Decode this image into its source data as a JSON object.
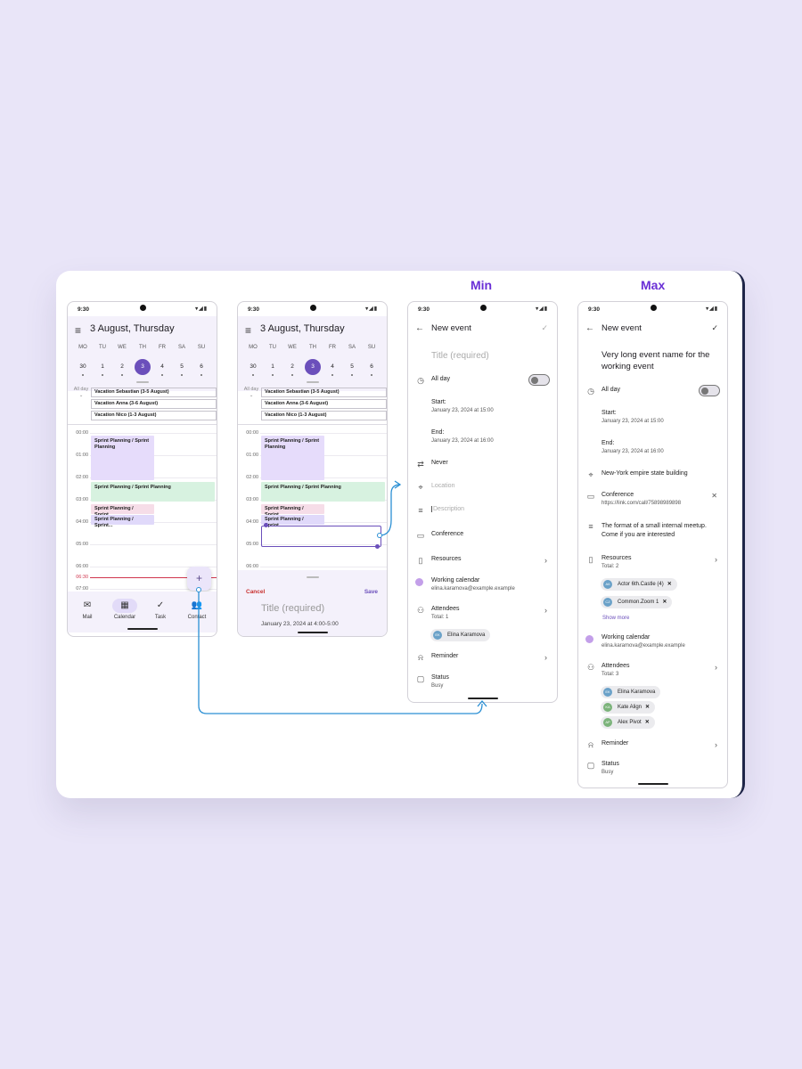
{
  "labels": {
    "min": "Min",
    "max": "Max"
  },
  "status": {
    "time": "9:30"
  },
  "calendar": {
    "title": "3 August, Thursday",
    "weekdays": [
      "MO",
      "TU",
      "WE",
      "TH",
      "FR",
      "SA",
      "SU"
    ],
    "dates": [
      "30",
      "1",
      "2",
      "3",
      "4",
      "5",
      "6"
    ],
    "selected_date": "3",
    "allday_label": "All day",
    "vacations": [
      "Vacation Sebastian (3-5 August)",
      "Vacation Anna (3-6 August)",
      "Vacation Nico (1-3 August)"
    ],
    "hours": [
      "00:00",
      "01:00",
      "02:00",
      "03:00",
      "04:00",
      "05:00",
      "06:00",
      "07:00"
    ],
    "now_time": "06:30",
    "events": [
      "Sprint Planning  / Sprint Planning",
      "Sprint Planning / Sprint Planning",
      "Sprint Planning / Sprint...",
      "Sprint Planning / Sprint..."
    ],
    "fab": "+",
    "nav": [
      {
        "icon": "✉",
        "label": "Mail"
      },
      {
        "icon": "▦",
        "label": "Calendar"
      },
      {
        "icon": "✓",
        "label": "Task"
      },
      {
        "icon": "👥",
        "label": "Contact"
      }
    ]
  },
  "quick_create": {
    "cancel": "Cancel",
    "save": "Save",
    "title_placeholder": "Title (required)",
    "datetime": "January 23, 2024 at 4:00-5:00"
  },
  "min_form": {
    "header": "New event",
    "title_placeholder": "Title (required)",
    "allday": "All day",
    "start_label": "Start:",
    "start_value": "January 23, 2024 at 15:00",
    "end_label": "End:",
    "end_value": "January 23, 2024 at 16:00",
    "repeat": "Never",
    "location_placeholder": "Location",
    "description_placeholder": "Description",
    "conference": "Conference",
    "resources": "Resources",
    "calendar_name": "Working calendar",
    "calendar_email": "elina.karamova@example.example",
    "attendees": "Attendees",
    "attendees_total": "Total: 1",
    "attendee_chips": [
      {
        "initials": "EK",
        "name": "Elina Karamova"
      }
    ],
    "reminder": "Reminder",
    "status_label": "Status",
    "status_value": "Busy"
  },
  "max_form": {
    "header": "New event",
    "title": "Very long event name for the working event",
    "allday": "All day",
    "start_label": "Start:",
    "start_value": "January 23, 2024 at 15:00",
    "end_label": "End:",
    "end_value": "January 23, 2024 at 16:00",
    "location": "New-York empire state building",
    "conference": "Conference",
    "conference_link": "https://link.com/call/75898989898",
    "description": "The format of a small internal meetup. Come if you are interested",
    "resources": "Resources",
    "resources_total": "Total: 2",
    "resource_chips": [
      {
        "initials": "A6",
        "name": "Actor 6th.Castle (4)"
      },
      {
        "initials": "CZ",
        "name": "Common.Zoom 1"
      }
    ],
    "show_more": "Show more",
    "calendar_name": "Working calendar",
    "calendar_email": "elina.karamova@example.example",
    "attendees": "Attendees",
    "attendees_total": "Total: 3",
    "attendee_chips": [
      {
        "initials": "EK",
        "name": "Elina Karamova"
      },
      {
        "initials": "KA",
        "name": "Kate Align"
      },
      {
        "initials": "AP",
        "name": "Alex Pivot"
      }
    ],
    "reminder": "Reminder",
    "status_label": "Status",
    "status_value": "Busy"
  },
  "colors": {
    "accent": "#6b4fbb",
    "label": "#6a2fd6",
    "connector": "#2a8fd4",
    "now_line": "#d0364e"
  }
}
